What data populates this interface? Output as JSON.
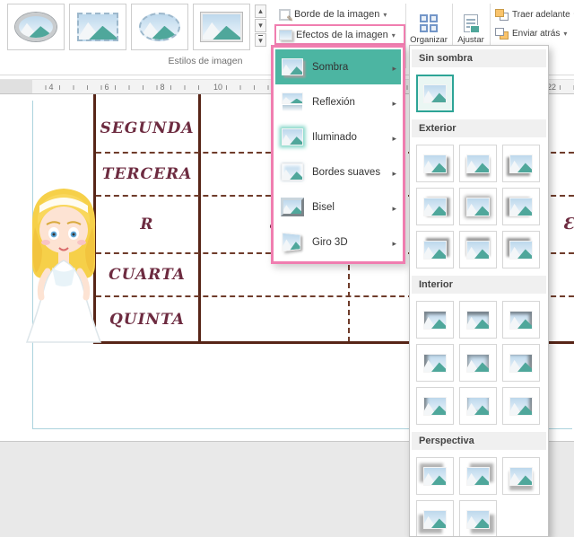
{
  "ribbon": {
    "style_gallery": {
      "group_label": "Estilos de imagen",
      "styles": [
        {
          "name": "metal-oval-frame"
        },
        {
          "name": "perforated-edge-rectangle"
        },
        {
          "name": "perforated-edge-oval"
        },
        {
          "name": "simple-white-frame"
        }
      ]
    },
    "buttons": {
      "picture_border": "Borde de la imagen",
      "picture_effects": "Efectos de la imagen",
      "organize": "Organizar",
      "adjust": "Ajustar",
      "bring_forward": "Traer adelante",
      "send_backward": "Enviar atrás"
    }
  },
  "effects_menu": {
    "items": [
      {
        "label": "Sombra",
        "icon": "shadow",
        "highlighted": true
      },
      {
        "label": "Reflexión",
        "icon": "reflection",
        "highlighted": false
      },
      {
        "label": "Iluminado",
        "icon": "glow",
        "highlighted": false
      },
      {
        "label": "Bordes suaves",
        "icon": "soft-edges",
        "highlighted": false
      },
      {
        "label": "Bisel",
        "icon": "bevel",
        "highlighted": false
      },
      {
        "label": "Giro 3D",
        "icon": "rotation-3d",
        "highlighted": false
      }
    ]
  },
  "shadow_menu": {
    "sections": [
      {
        "title": "Sin sombra",
        "thumbs": [
          {
            "style": "none",
            "selected": true
          }
        ]
      },
      {
        "title": "Exterior",
        "thumbs": [
          {
            "style": "br"
          },
          {
            "style": "b"
          },
          {
            "style": "bl"
          },
          {
            "style": "r"
          },
          {
            "style": "c"
          },
          {
            "style": "l"
          },
          {
            "style": "tr"
          },
          {
            "style": "t"
          },
          {
            "style": "tl"
          }
        ]
      },
      {
        "title": "Interior",
        "thumbs": [
          {
            "style": "in-tl"
          },
          {
            "style": "in-t"
          },
          {
            "style": "in-tr"
          },
          {
            "style": "in-l"
          },
          {
            "style": "in-c"
          },
          {
            "style": "in-r"
          },
          {
            "style": "in-bl"
          },
          {
            "style": "in-b"
          },
          {
            "style": "in-br"
          }
        ]
      },
      {
        "title": "Perspectiva",
        "thumbs": [
          {
            "style": "p-ul"
          },
          {
            "style": "p-ur"
          },
          {
            "style": "p-b"
          },
          {
            "style": "p-ll"
          },
          {
            "style": "p-lr"
          }
        ]
      }
    ]
  },
  "document": {
    "ruler_numbers": [
      "4",
      "6",
      "8",
      "10",
      "22"
    ],
    "table_rows": [
      "SEGUNDA",
      "TERCERA",
      "R",
      "CUARTA",
      "QUINTA"
    ],
    "column_letter": "Ɛ"
  },
  "colors": {
    "annotation_pink": "#f07eb0",
    "menu_highlight_teal": "#4cb5a2",
    "selected_border_teal": "#2da496",
    "table_line_brown": "#572517",
    "table_text_maroon": "#6d2b40"
  }
}
